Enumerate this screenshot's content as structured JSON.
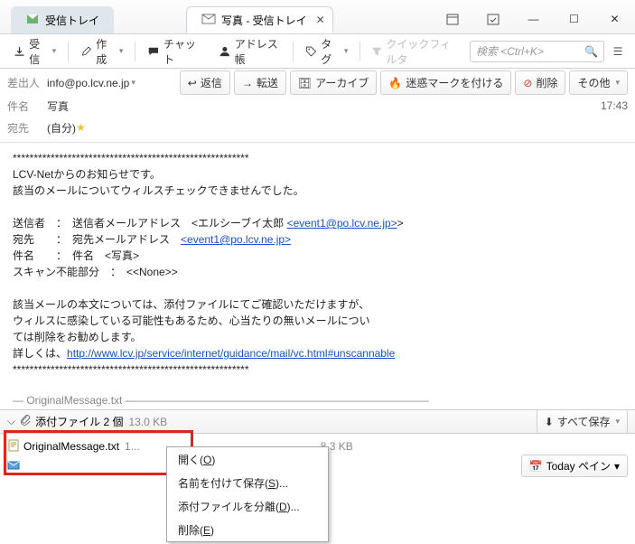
{
  "window": {
    "tab_inactive": "受信トレイ",
    "tab_active": "写真 - 受信トレイ"
  },
  "toolbar": {
    "receive": "受信",
    "compose": "作成",
    "chat": "チャット",
    "addressbook": "アドレス帳",
    "tag": "タグ",
    "quickfilter": "クイックフィルタ",
    "search_placeholder": "検索 <Ctrl+K>"
  },
  "actions": {
    "reply": "返信",
    "forward": "転送",
    "archive": "アーカイブ",
    "junk": "迷惑マークを付ける",
    "delete": "削除",
    "other": "その他"
  },
  "header": {
    "from_label": "差出人",
    "from_value": "info@po.lcv.ne.jp",
    "subject_label": "件名",
    "subject_value": "写真",
    "time": "17:43",
    "to_label": "宛先",
    "to_value": "(自分)"
  },
  "body": {
    "stars1": "********************************************************",
    "l1": "LCV-Netからのお知らせです。",
    "l2": "該当のメールについてウィルスチェックできませんでした。",
    "l3a": "送信者　：　送信者メールアドレス　<エルシーブイ太郎 ",
    "l3link": "<event1@po.lcv.ne.jp>",
    "l3b": ">",
    "l4a": "宛先　　：　宛先メールアドレス　",
    "l4link": "<event1@po.lcv.ne.jp>",
    "l5": "件名　　：　件名　<写真>",
    "l6": "スキャン不能部分　：　<<None>>",
    "l7": "該当メールの本文については、添付ファイルにてご確認いただけますが、",
    "l8": "ウィルスに感染している可能性もあるため、心当たりの無いメールについ",
    "l9": "ては削除をお勧めします。",
    "l10a": "詳しくは、",
    "l10link": "http://www.lcv.jp/service/internet/guidance/mail/vc.html#unscannable",
    "stars2": "********************************************************",
    "origmsg": "OriginalMessage.txt"
  },
  "attachments": {
    "bar_label": "添付ファイル 2 個",
    "bar_size": "13.0 KB",
    "save_all": "すべて保存",
    "file1_name": "OriginalMessage.txt",
    "file1_size": "1...",
    "file2_size": "8.3 KB"
  },
  "context_menu": {
    "open": "開く(O)",
    "saveas": "名前を付けて保存(S)...",
    "detach": "添付ファイルを分離(D)...",
    "delete": "削除(E)"
  },
  "today_pane": "Today ペイン"
}
